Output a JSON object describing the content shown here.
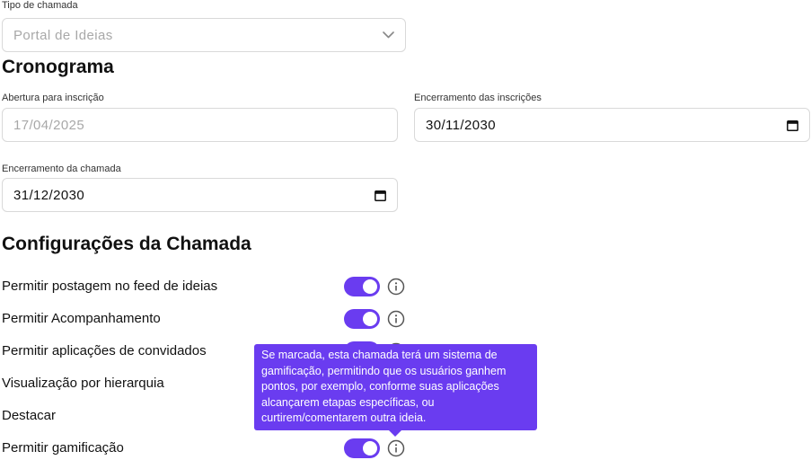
{
  "tipo": {
    "label": "Tipo de chamada",
    "value": "Portal de Ideias"
  },
  "cronograma": {
    "title": "Cronograma",
    "abertura_label": "Abertura para inscrição",
    "abertura_value": "17/04/2025",
    "encerramento_insc_label": "Encerramento das inscrições",
    "encerramento_insc_value": "30/11/2030",
    "encerramento_chamada_label": "Encerramento da chamada",
    "encerramento_chamada_value": "31/12/2030"
  },
  "config": {
    "title": "Configurações da Chamada",
    "items": [
      {
        "label": "Permitir postagem no feed de ideias",
        "enabled": true
      },
      {
        "label": "Permitir Acompanhamento",
        "enabled": true
      },
      {
        "label": "Permitir aplicações de convidados",
        "enabled": true
      },
      {
        "label": "Visualização por hierarquia",
        "enabled": true
      },
      {
        "label": "Destacar",
        "enabled": true
      },
      {
        "label": "Permitir gamificação",
        "enabled": true
      }
    ]
  },
  "tooltip": {
    "line1": "Se marcada, esta chamada terá um sistema de",
    "line2": "gamificação, permitindo que os usuários ganhem",
    "line3": "pontos, por exemplo, conforme suas aplicações",
    "line4": "alcançarem etapas específicas, ou",
    "line5": "curtirem/comentarem outra ideia."
  },
  "colors": {
    "accent": "#6a3cf0",
    "border": "#d9d9d9"
  }
}
